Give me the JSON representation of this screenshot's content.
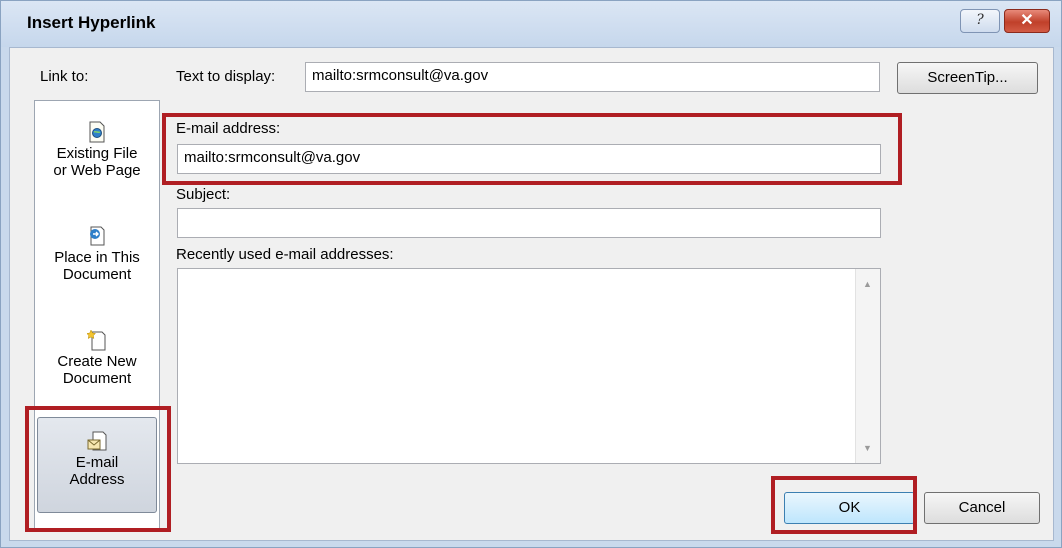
{
  "window": {
    "title": "Insert Hyperlink",
    "help_glyph": "?",
    "close_glyph": "✕"
  },
  "link_to": {
    "label": "Link to:",
    "items": [
      {
        "label_line1": "Existing File",
        "label_line2": "or Web Page",
        "icon": "existing-file-icon"
      },
      {
        "label_line1": "Place in This",
        "label_line2": "Document",
        "icon": "place-in-document-icon"
      },
      {
        "label_line1": "Create New",
        "label_line2": "Document",
        "icon": "create-new-document-icon"
      },
      {
        "label_line1": "E-mail",
        "label_line2": "Address",
        "icon": "email-address-icon",
        "selected": true
      }
    ]
  },
  "text_to_display": {
    "label": "Text to display:",
    "value": "mailto:srmconsult@va.gov"
  },
  "screentip_button": "ScreenTip...",
  "email_address": {
    "label": "E-mail address:",
    "value": "mailto:srmconsult@va.gov"
  },
  "subject": {
    "label": "Subject:",
    "value": ""
  },
  "recent_addresses": {
    "label": "Recently used e-mail addresses:",
    "items": []
  },
  "buttons": {
    "ok": "OK",
    "cancel": "Cancel"
  },
  "colors": {
    "highlight": "#b01e23",
    "title_bar": "#c6d7ec",
    "dialog_bg": "#f0f0f0"
  }
}
